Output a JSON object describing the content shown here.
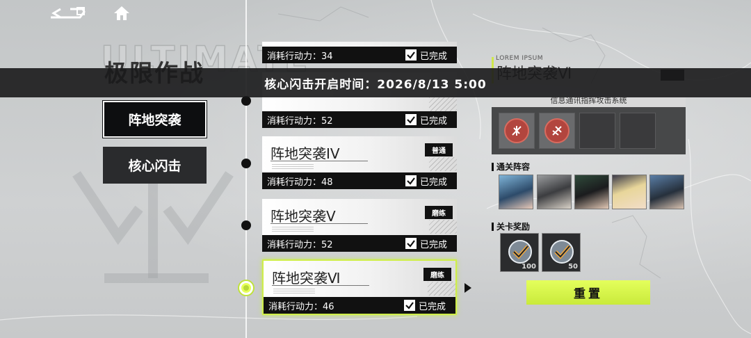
{
  "banner": {
    "text": "核心闪击开启时间：2026/8/13 5:00"
  },
  "left": {
    "ghost_text": "ULTIMATE",
    "mode_title": "极限作战",
    "modes": [
      {
        "label": "阵地突袭",
        "active": true
      },
      {
        "label": "核心闪击",
        "active": false
      }
    ]
  },
  "stages": [
    {
      "name": "",
      "difficulty": "",
      "cost_label": "消耗行动力：34",
      "status": "已完成"
    },
    {
      "name": "",
      "difficulty": "",
      "cost_label": "消耗行动力：52",
      "status": "已完成"
    },
    {
      "name": "阵地突袭IV",
      "difficulty": "普通",
      "cost_label": "消耗行动力：48",
      "status": "已完成"
    },
    {
      "name": "阵地突袭Ⅴ",
      "difficulty": "磨练",
      "cost_label": "消耗行动力：52",
      "status": "已完成"
    },
    {
      "name": "阵地突袭Ⅵ",
      "difficulty": "磨练",
      "cost_label": "消耗行动力：46",
      "status": "已完成",
      "active": true
    }
  ],
  "detail": {
    "lorem": "LOREM IPSUM",
    "title": "阵地突袭Ⅵ",
    "subtitle": "信息通讯指挥攻击系统",
    "team_label": "通关阵容",
    "reward_label": "关卡奖励",
    "rewards": [
      {
        "qty": "100"
      },
      {
        "qty": "50"
      }
    ],
    "reset_label": "重置"
  },
  "colors": {
    "accent": "#d4f04a",
    "dark": "#111111"
  },
  "icons": [
    "back-icon",
    "home-icon",
    "checkbox-icon",
    "reward-check-icon"
  ]
}
